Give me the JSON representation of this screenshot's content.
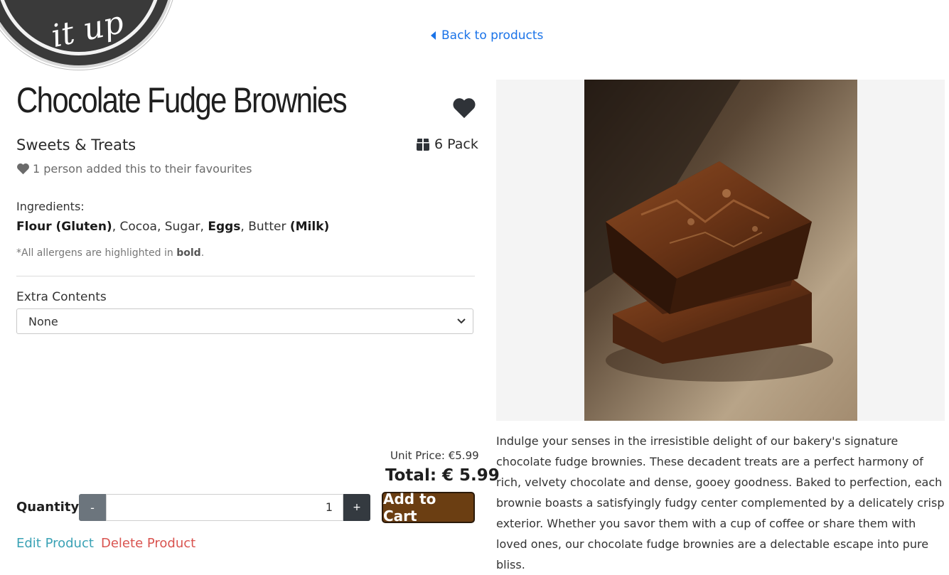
{
  "nav": {
    "back_label": "Back to products"
  },
  "logo": {
    "text": "it up"
  },
  "product": {
    "name": "Chocolate Fudge Brownies",
    "category": "Sweets & Treats",
    "size": "6 Pack",
    "favourites_text": "1 person added this to their favourites",
    "ingredients_label": "Ingredients:",
    "ingredients": [
      {
        "text": "Flour (Gluten)",
        "allergen": true
      },
      {
        "text": ", Cocoa, Sugar, ",
        "allergen": false
      },
      {
        "text": "Eggs",
        "allergen": true
      },
      {
        "text": ", Butter ",
        "allergen": false
      },
      {
        "text": "(Milk)",
        "allergen": true
      }
    ],
    "allergen_note_prefix": "*All allergens are highlighted in ",
    "allergen_note_bold": "bold",
    "allergen_note_suffix": ".",
    "extra_label": "Extra Contents",
    "extra_selected": "None",
    "unit_price": "Unit Price: €5.99",
    "total": "Total: € 5.99",
    "quantity_label": "Quantity:",
    "quantity_value": "1",
    "minus_label": "-",
    "plus_label": "+",
    "add_to_cart": "Add to Cart",
    "edit_label": "Edit Product",
    "delete_label": "Delete Product",
    "description": "Indulge your senses in the irresistible delight of our bakery's signature chocolate fudge brownies. These decadent treats are a perfect harmony of rich, velvety chocolate and dense, gooey goodness. Baked to perfection, each brownie boasts a satisfyingly fudgy center complemented by a delicately crisp exterior. Whether you savor them with a cup of coffee or share them with loved ones, our chocolate fudge brownies are a delectable escape into pure bliss."
  },
  "icons": {
    "back": "caret-left-icon",
    "favourite": "heart-icon",
    "pack": "box-icon",
    "select": "chevron-down-icon"
  },
  "colors": {
    "link": "#1a73e8",
    "add_to_cart_bg": "#6b3e12",
    "edit": "#3aa2b5",
    "delete": "#d9534f",
    "minus_bg": "#6c757d",
    "plus_bg": "#343a40"
  }
}
